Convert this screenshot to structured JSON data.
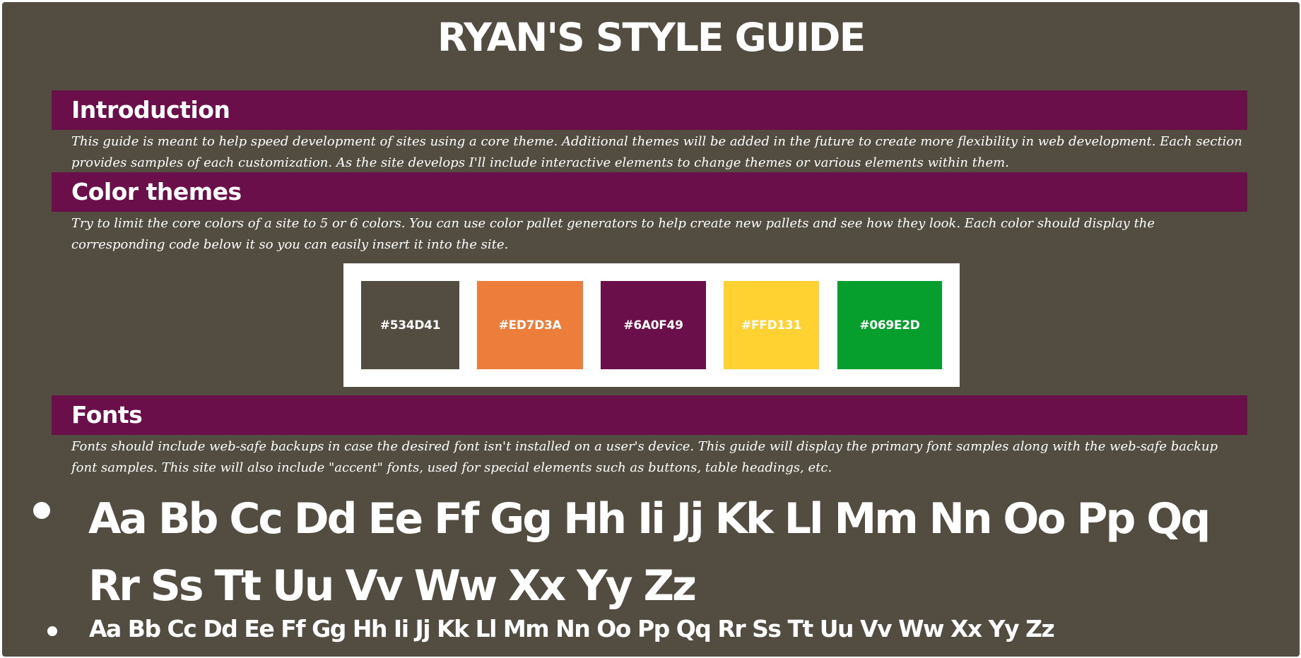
{
  "page": {
    "title": "RYAN'S STYLE GUIDE"
  },
  "sections": {
    "introduction": {
      "heading": "Introduction",
      "text": "This guide is meant to help speed development of sites using a core theme. Additional themes will be added in the future to create more flexibility in web development. Each section provides samples of each customization. As the site develops I'll include interactive elements to change themes or various elements within them."
    },
    "color_themes": {
      "heading": "Color themes",
      "text": "Try to limit the core colors of a site to 5 or 6 colors. You can use color pallet generators to help create new pallets and see how they look. Each color should display the corresponding code below it so you can easily insert it into the site."
    },
    "fonts": {
      "heading": "Fonts",
      "text": "Fonts should include web-safe backups in case the desired font isn't installed on a user's device. This guide will display the primary font samples along with the web-safe backup font samples. This site will also include \"accent\" fonts, used for special elements such as buttons, table headings, etc."
    }
  },
  "palette": [
    {
      "code": "#534D41",
      "color": "#534D41"
    },
    {
      "code": "#ED7D3A",
      "color": "#ED7D3A"
    },
    {
      "code": "#6A0F49",
      "color": "#6A0F49"
    },
    {
      "code": "#FFD131",
      "color": "#FFD131"
    },
    {
      "code": "#069E2D",
      "color": "#069E2D"
    }
  ],
  "font_samples": [
    {
      "sample": "Aa Bb Cc Dd Ee Ff Gg Hh Ii Jj Kk Ll Mm Nn Oo Pp Qq Rr Ss Tt Uu Vv Ww Xx Yy Zz"
    },
    {
      "sample": "Aa Bb Cc Dd Ee Ff Gg Hh Ii Jj Kk Ll Mm Nn Oo Pp Qq Rr Ss Tt Uu Vv Ww Xx Yy Zz"
    }
  ],
  "colors": {
    "background": "#534D41",
    "section_bar": "#6A0F49",
    "text": "#ffffff"
  }
}
